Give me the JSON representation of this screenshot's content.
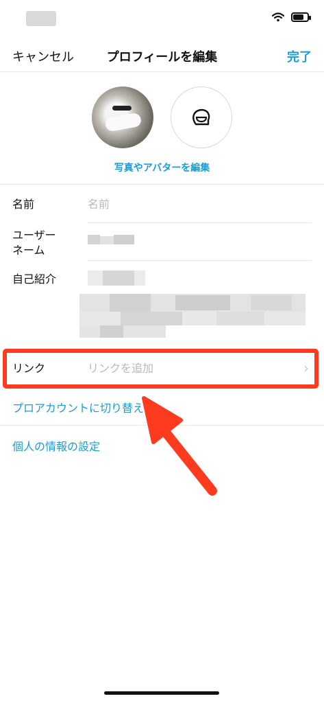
{
  "nav": {
    "cancel": "キャンセル",
    "title": "プロフィールを編集",
    "done": "完了"
  },
  "profile": {
    "edit_photo_label": "写真やアバターを編集"
  },
  "fields": {
    "name_label": "名前",
    "name_placeholder": "名前",
    "username_label_line1": "ユーザー",
    "username_label_line2": "ネーム",
    "bio_label": "自己紹介",
    "link_label": "リンク",
    "link_placeholder": "リンクを追加"
  },
  "links": {
    "switch_pro": "プロアカウントに切り替える",
    "personal_info": "個人の情報の設定"
  },
  "colors": {
    "accent": "#1a9cd8",
    "highlight": "#ff3b1f"
  },
  "status": {
    "battery_level": 0.75
  }
}
